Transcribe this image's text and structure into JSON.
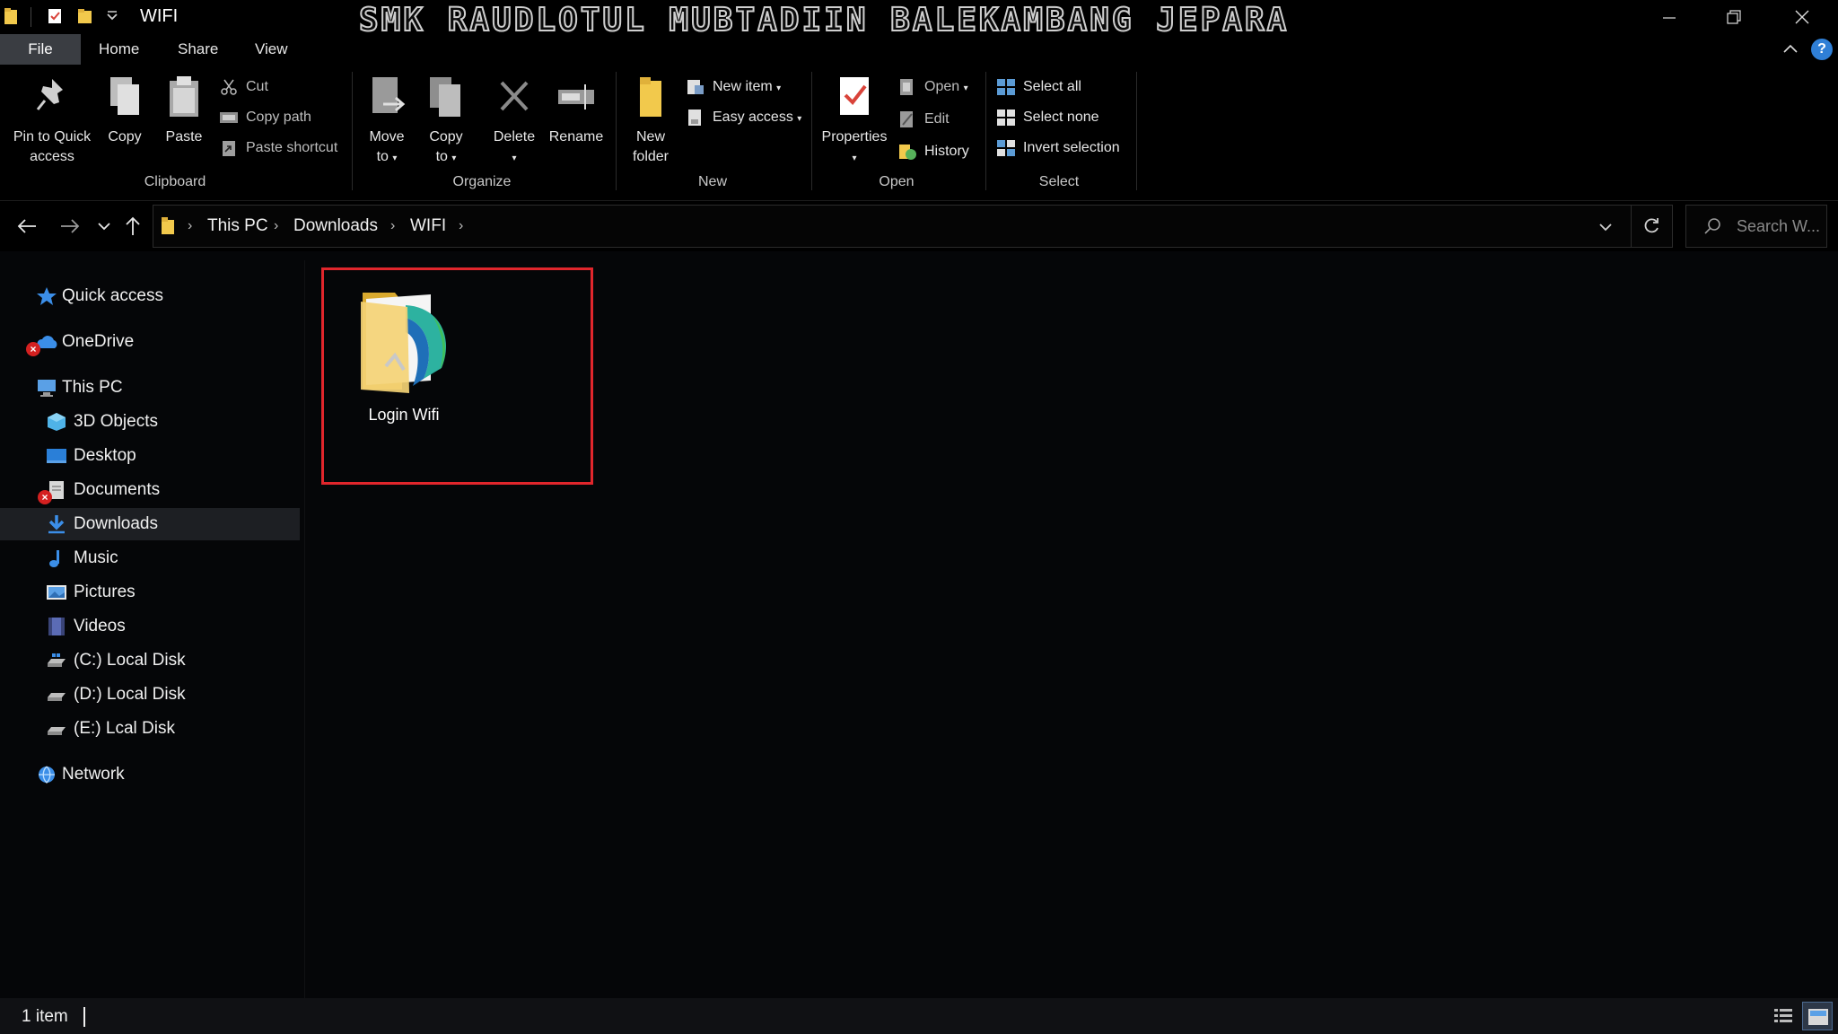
{
  "window": {
    "title": "WIFI",
    "banner": "SMK RAUDLOTUL MUBTADIIN BALEKAMBANG JEPARA"
  },
  "ribbon_tabs": [
    "File",
    "Home",
    "Share",
    "View"
  ],
  "help_label": "?",
  "clipboard": {
    "pin": "Pin to Quick access",
    "pin_line1": "Pin to Quick",
    "pin_line2": "access",
    "copy": "Copy",
    "paste": "Paste",
    "cut": "Cut",
    "copy_path": "Copy path",
    "paste_shortcut": "Paste shortcut",
    "group": "Clipboard"
  },
  "organize": {
    "move_to_1": "Move",
    "move_to_2": "to",
    "copy_to_1": "Copy",
    "copy_to_2": "to",
    "delete": "Delete",
    "rename": "Rename",
    "group": "Organize"
  },
  "new": {
    "new_folder_1": "New",
    "new_folder_2": "folder",
    "new_item": "New item",
    "easy_access": "Easy access",
    "group": "New"
  },
  "open": {
    "properties": "Properties",
    "open": "Open",
    "edit": "Edit",
    "history": "History",
    "group": "Open"
  },
  "select": {
    "select_all": "Select all",
    "select_none": "Select none",
    "invert_selection": "Invert selection",
    "group": "Select"
  },
  "breadcrumb": [
    "This PC",
    "Downloads",
    "WIFI"
  ],
  "search": {
    "placeholder": "Search W..."
  },
  "nav": {
    "quick_access": "Quick access",
    "onedrive": "OneDrive",
    "this_pc": "This PC",
    "objects3d": "3D Objects",
    "desktop": "Desktop",
    "documents": "Documents",
    "downloads": "Downloads",
    "music": "Music",
    "pictures": "Pictures",
    "videos": "Videos",
    "c_drive": "(C:) Local Disk",
    "d_drive": "(D:) Local Disk",
    "e_drive": "(E:) Lcal Disk",
    "network": "Network"
  },
  "files": [
    {
      "name": "Login Wifi",
      "type": "folder"
    }
  ],
  "status": {
    "count": "1 item"
  },
  "colors": {
    "highlight": "#e1262c",
    "folder": "#f2c94c",
    "selected_nav": "#1d1f23",
    "accent": "#2f7fd6"
  }
}
